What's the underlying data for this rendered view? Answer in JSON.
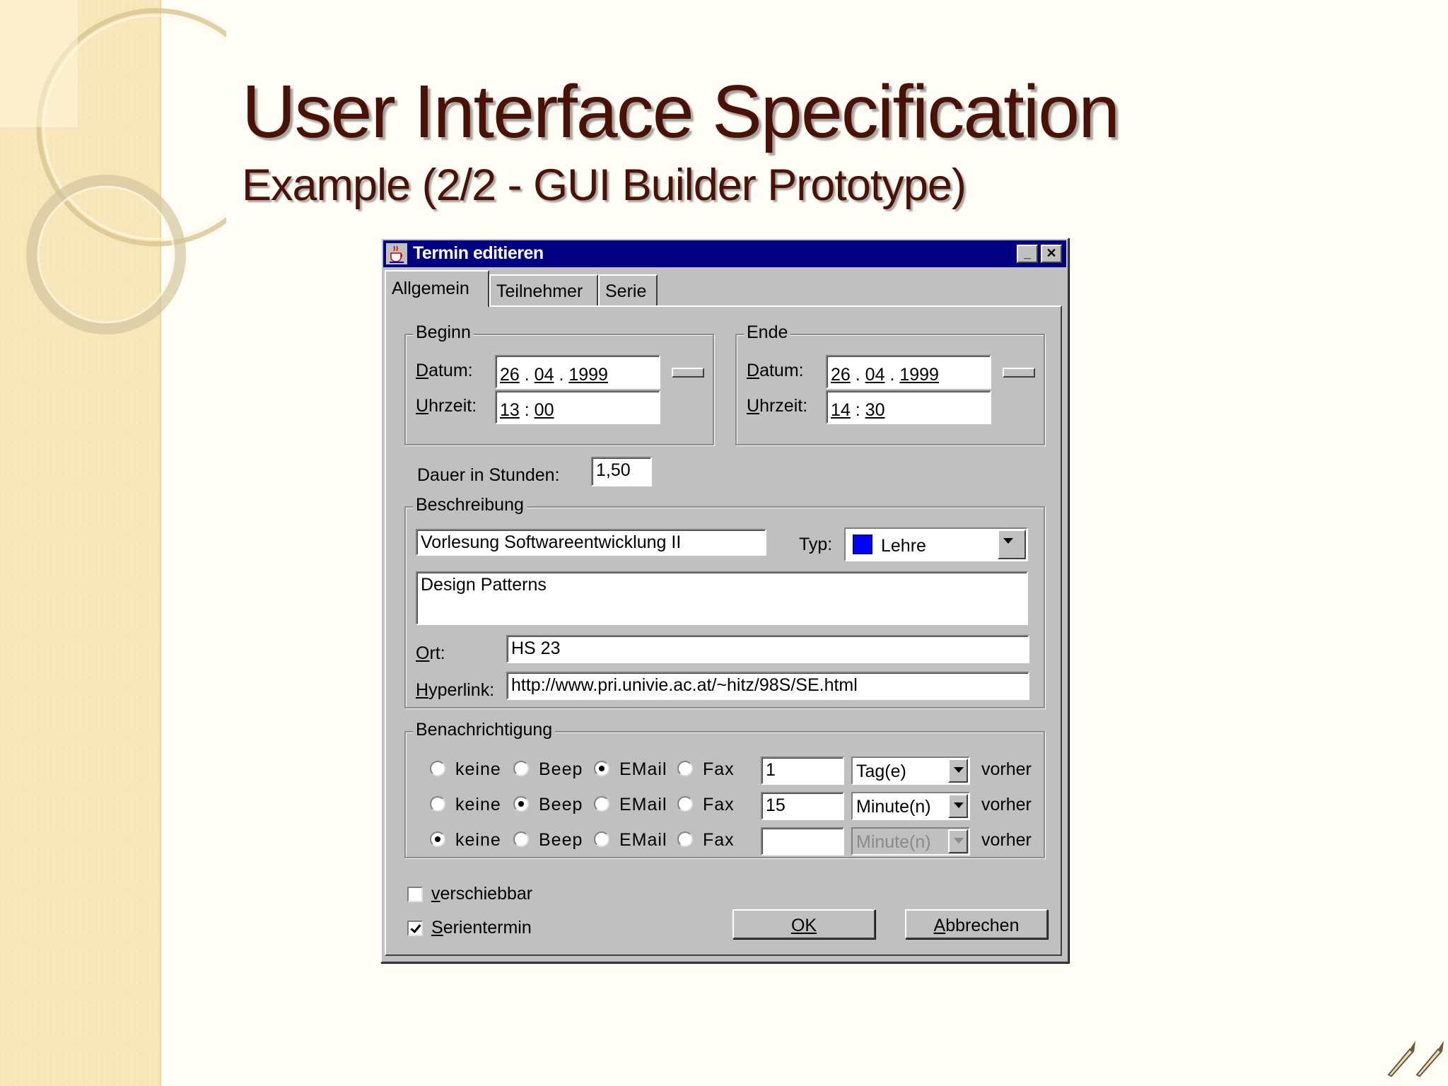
{
  "slide": {
    "title": "User Interface Specification",
    "subtitle": "Example (2/2 - GUI Builder Prototype)"
  },
  "dialog": {
    "title": "Termin editieren",
    "minimize_icon": "minimize-icon",
    "close_icon": "close-icon",
    "tabs": [
      {
        "label": "Allgemein",
        "active": true
      },
      {
        "label": "Teilnehmer",
        "active": false
      },
      {
        "label": "Serie",
        "active": false
      }
    ],
    "begin": {
      "legend": "Beginn",
      "date_label": "Datum:",
      "time_label": "Uhrzeit:",
      "day": "26",
      "month": "04",
      "year": "1999",
      "hour": "13",
      "minute": "00"
    },
    "end": {
      "legend": "Ende",
      "date_label": "Datum:",
      "time_label": "Uhrzeit:",
      "day": "26",
      "month": "04",
      "year": "1999",
      "hour": "14",
      "minute": "30"
    },
    "date_sep": ".",
    "time_sep": ":",
    "duration": {
      "label": "Dauer in Stunden:",
      "value": "1,50"
    },
    "description": {
      "legend": "Beschreibung",
      "title_value": "Vorlesung Softwareentwicklung II",
      "type_label": "Typ:",
      "type_value": "Lehre",
      "type_color": "#0000ff",
      "text_value": "Design Patterns",
      "location_label": "Ort:",
      "location_value": "HS 23",
      "hyperlink_label": "Hyperlink:",
      "hyperlink_value": "http://www.pri.univie.ac.at/~hitz/98S/SE.html"
    },
    "notification": {
      "legend": "Benachrichtigung",
      "options": [
        "keine",
        "Beep",
        "EMail",
        "Fax"
      ],
      "suffix": "vorher",
      "rows": [
        {
          "selected": "EMail",
          "amount": "1",
          "unit": "Tag(e)",
          "enabled": true
        },
        {
          "selected": "Beep",
          "amount": "15",
          "unit": "Minute(n)",
          "enabled": true
        },
        {
          "selected": "keine",
          "amount": "",
          "unit": "Minute(n)",
          "enabled": false
        }
      ]
    },
    "movable": {
      "label": "verschiebbar",
      "checked": false
    },
    "series": {
      "label": "Serientermin",
      "checked": true
    },
    "ok_label": "OK",
    "cancel_label": "Abbrechen"
  }
}
